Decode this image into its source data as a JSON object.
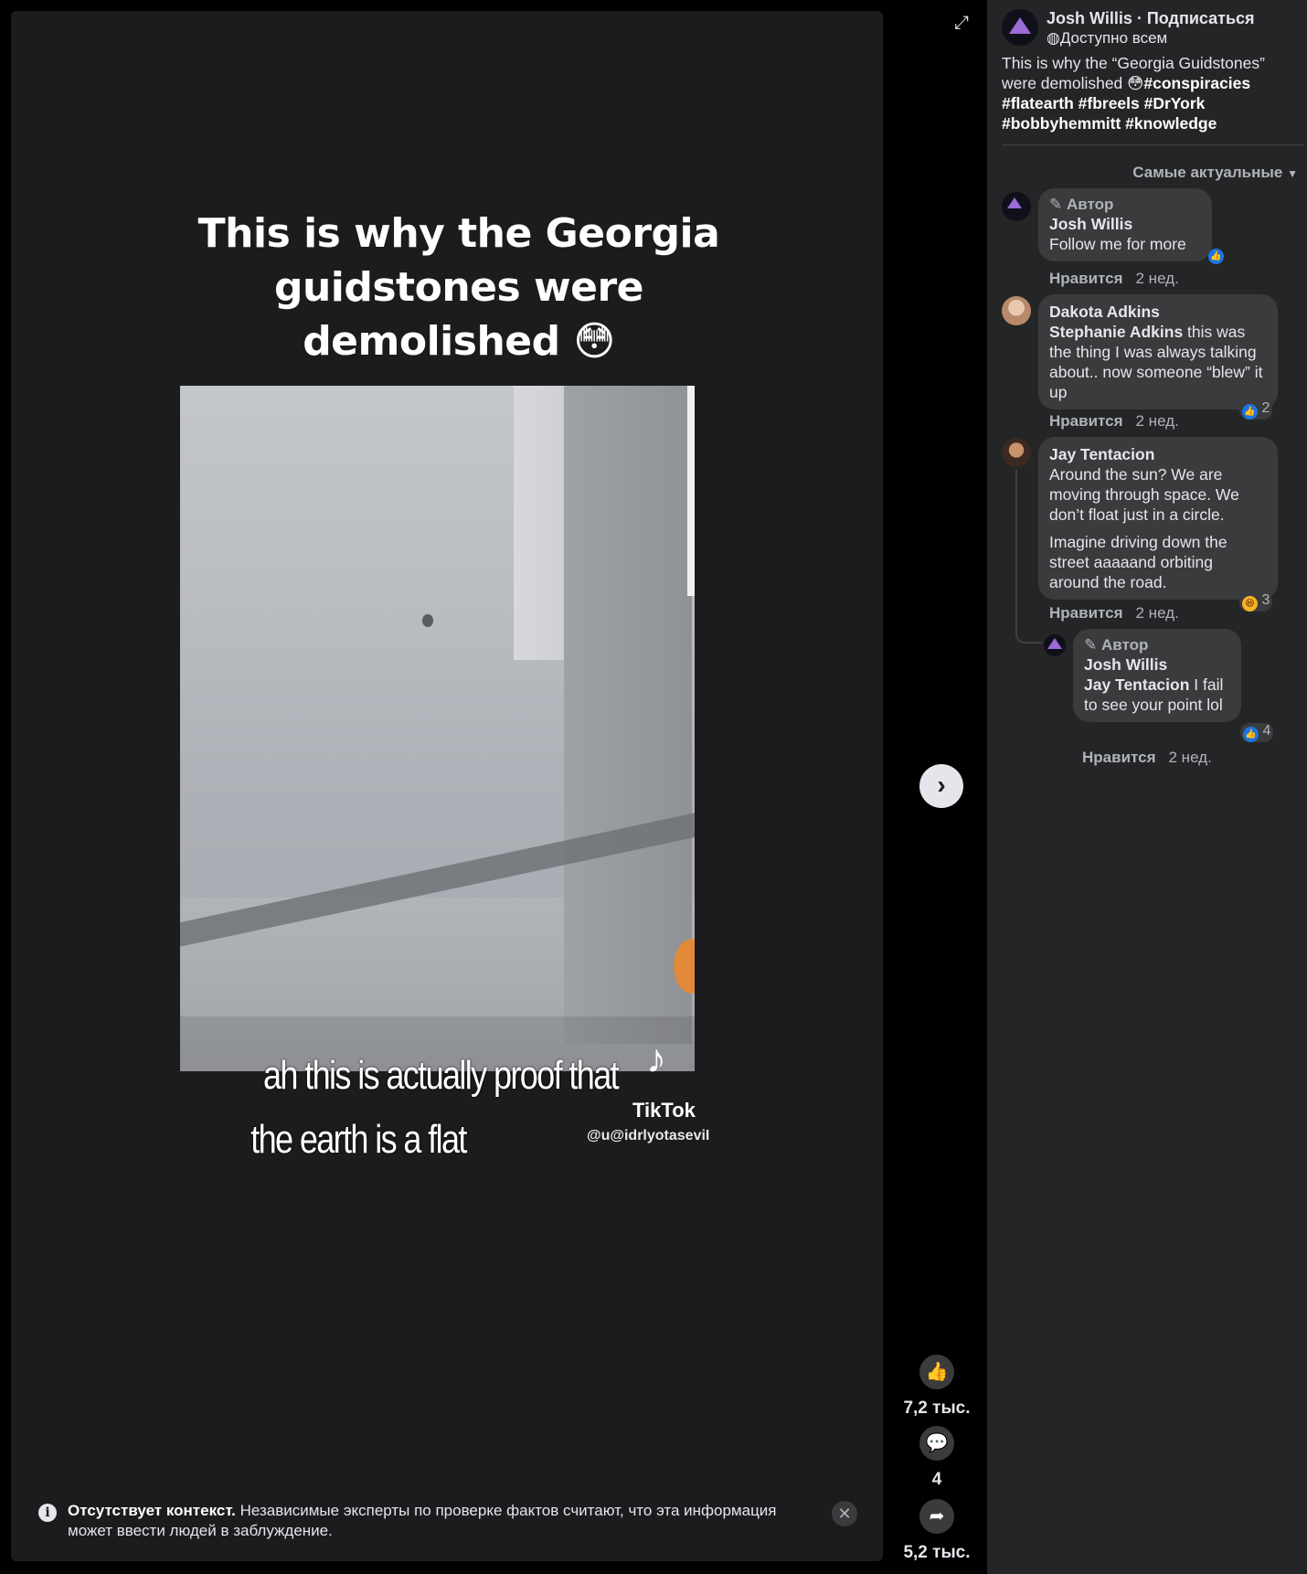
{
  "video": {
    "title": "This is why the Georgia guidstones were demolished 😳",
    "caption_line1": "ah this is actually proof that",
    "caption_line2": "the earth is a flat",
    "watermark_brand": "TikTok",
    "watermark_handle": "@u@idrlyotaseviI"
  },
  "notice": {
    "bold": "Отсутствует контекст.",
    "text": " Независимые эксперты по проверке фактов считают, что эта информация может ввести людей в заблуждение."
  },
  "rail": {
    "likes": "7,2 тыс.",
    "comments": "4",
    "shares": "5,2 тыс."
  },
  "post": {
    "author": "Josh Willis · Подписаться",
    "audience": "Доступно всем",
    "text": "This is why the “Georgia Guidstones” were demolished 😳",
    "hashtags": "#conspiracies #flatearth #fbreels #DrYork #bobbyhemmitt #knowledge"
  },
  "comments_sort": "Самые актуальные",
  "comments": [
    {
      "badge": "Автор",
      "name": "Josh Willis",
      "text": "Follow me for more",
      "like_label": "Нравится",
      "time": "2 нед."
    },
    {
      "name": "Dakota Adkins",
      "mention": "Stephanie Adkins",
      "text": " this was the thing I was always talking about.. now someone “blew” it up",
      "reactions": "2",
      "like_label": "Нравится",
      "time": "2 нед."
    },
    {
      "name": "Jay Tentacion",
      "text": "Around the sun? We are moving through space. We don’t float just in a circle.",
      "text2": "Imagine driving down the street aaaaand orbiting around the road.",
      "reactions": "3",
      "like_label": "Нравится",
      "time": "2 нед."
    },
    {
      "badge": "Автор",
      "name": "Josh Willis",
      "mention": "Jay Tentacion",
      "text": " I fail to see your point lol",
      "reactions": "4",
      "like_label": "Нравится",
      "time": "2 нед."
    }
  ],
  "colors": {
    "panel_bg": "#242526",
    "bubble_bg": "#3a3b3c",
    "like_blue": "#1b74e4",
    "stage_bg": "#1c1c1e"
  },
  "icons": [
    "expand-icon",
    "next-arrow-icon",
    "like-icon",
    "comment-icon",
    "share-icon",
    "info-icon",
    "close-icon",
    "globe-icon",
    "pencil-icon",
    "dropdown-icon"
  ]
}
